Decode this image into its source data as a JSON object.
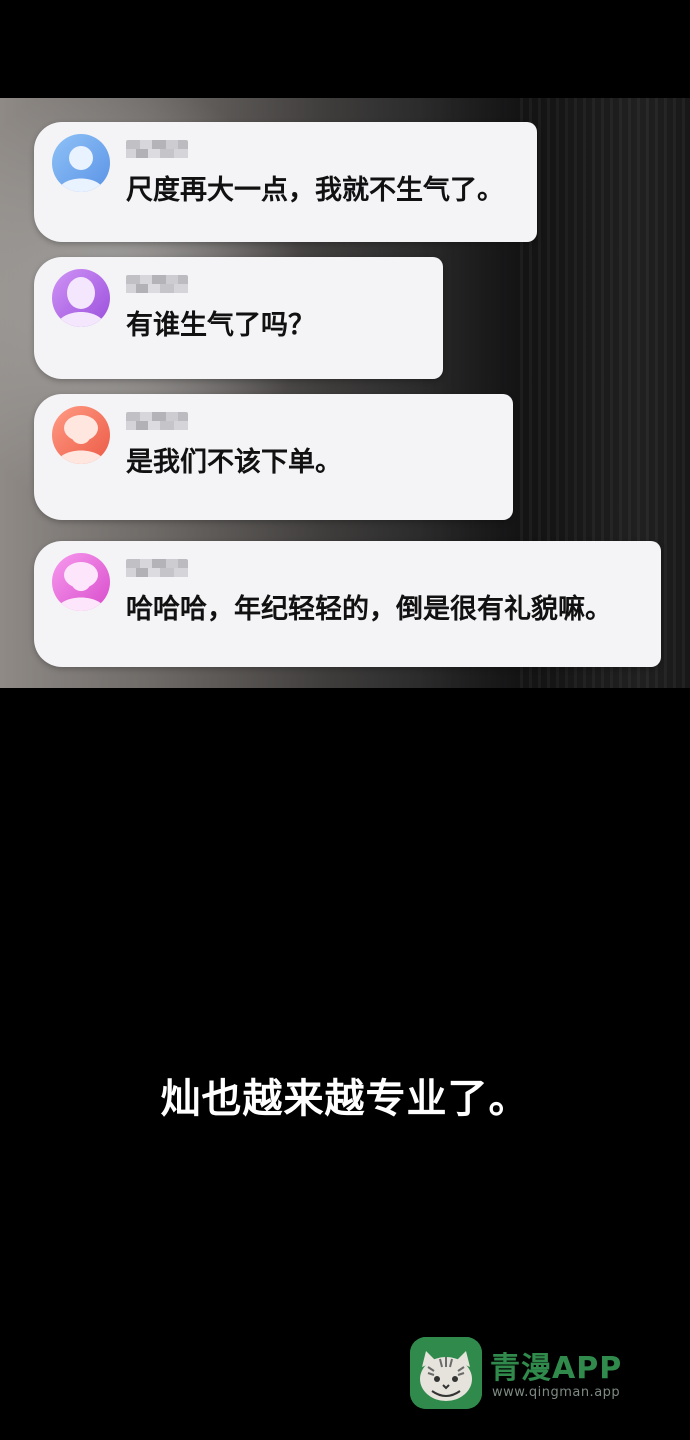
{
  "chat": {
    "messages": [
      {
        "avatar": "blue-user-avatar-icon",
        "color": "#6aa8ee",
        "text": "尺度再大一点，我就不生气了。"
      },
      {
        "avatar": "purple-user-avatar-icon",
        "color": "#b46be6",
        "text": "有谁生气了吗？"
      },
      {
        "avatar": "coral-user-avatar-icon",
        "color": "#f26f5c",
        "text": "是我们不该下单。"
      },
      {
        "avatar": "pink-user-avatar-icon",
        "color": "#ea5fd9",
        "text": "哈哈哈，年纪轻轻的，倒是很有礼貌嘛。"
      }
    ]
  },
  "narration": "灿也越来越专业了。",
  "watermark": {
    "title": "青漫APP",
    "url": "www.qingman.app",
    "logo_icon": "cat-logo-icon",
    "color": "#2f8a4c"
  }
}
